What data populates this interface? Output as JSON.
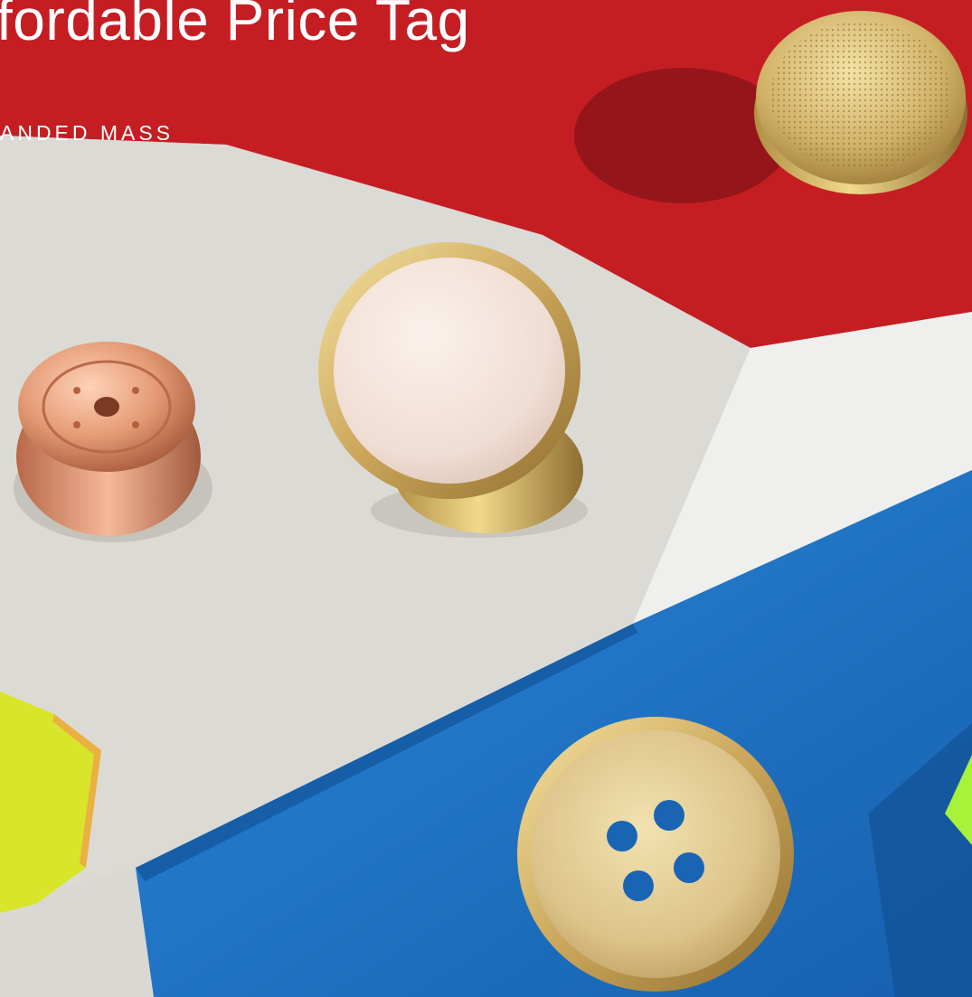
{
  "hero": {
    "title": "fordable Price Tag",
    "subtitle": "ANDED MASS"
  },
  "palette": {
    "red_paper": "#c41e23",
    "grey_paper": "#dcdad5",
    "white_paper": "#efefef",
    "blue_paper": "#1a6fc4",
    "neon_yellow": "#e0ea2a",
    "neon_green": "#a8f23a",
    "gold": "#d9c17a",
    "copper": "#e09a76",
    "ivory": "#f4e6df"
  },
  "image": {
    "subject": "buttons on coloured paper",
    "objects": [
      "gold-mesh-button",
      "copper-rivet-button",
      "ivory-inlay-button",
      "gold-four-hole-button",
      "neon-yellow-acrylic",
      "neon-green-acrylic"
    ]
  }
}
